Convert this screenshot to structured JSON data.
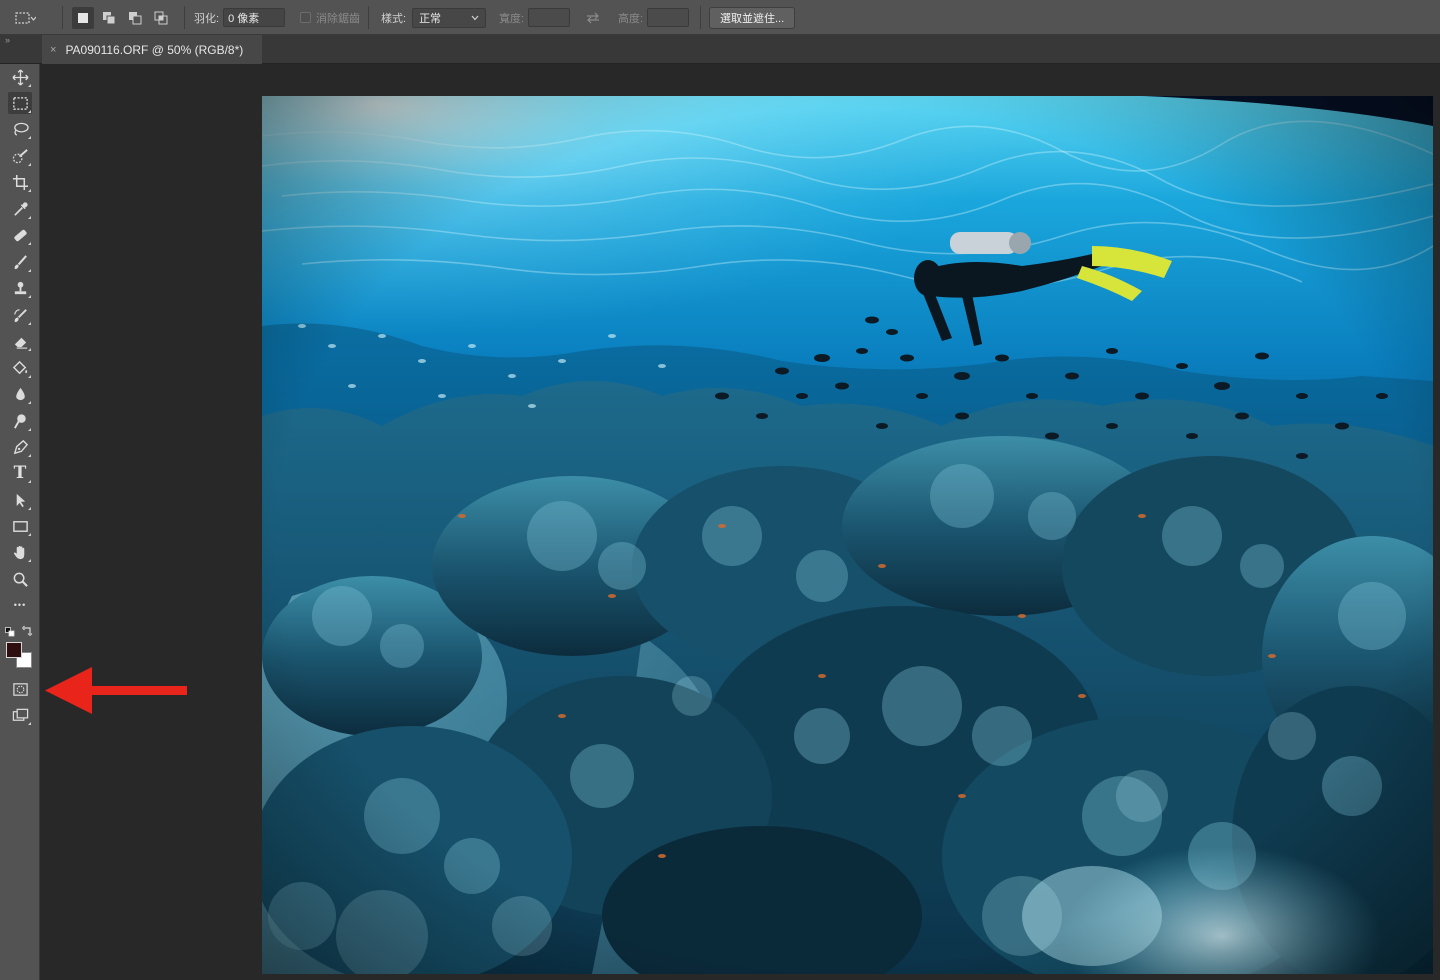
{
  "options_bar": {
    "feather_label": "羽化:",
    "feather_value": "0 像素",
    "antialias_label": "消除鋸齒",
    "style_label": "樣式:",
    "style_value": "正常",
    "width_label": "寬度:",
    "height_label": "高度:",
    "select_mask_label": "選取並遮住..."
  },
  "document": {
    "tab_title": "PA090116.ORF @ 50% (RGB/8*)",
    "close_glyph": "×"
  },
  "panel_collapse_glyph": "››",
  "colors": {
    "foreground": "#2e0e0e",
    "background": "#ffffff",
    "annotation_arrow": "#e8241b"
  },
  "toolbox": {
    "tools": [
      "move-tool-icon",
      "rectangular-marquee-tool-icon",
      "lasso-tool-icon",
      "quick-selection-tool-icon",
      "crop-tool-icon",
      "eyedropper-tool-icon",
      "healing-brush-tool-icon",
      "brush-tool-icon",
      "clone-stamp-tool-icon",
      "history-brush-tool-icon",
      "eraser-tool-icon",
      "paint-bucket-tool-icon",
      "blur-tool-icon",
      "dodge-tool-icon",
      "pen-tool-icon",
      "type-tool-icon",
      "path-selection-tool-icon",
      "rectangle-tool-icon",
      "hand-tool-icon",
      "zoom-tool-icon",
      "edit-toolbar-icon",
      "quick-mask-mode-icon",
      "screen-mode-icon"
    ],
    "type_tool_glyph": "T",
    "more_glyph": "•••"
  }
}
